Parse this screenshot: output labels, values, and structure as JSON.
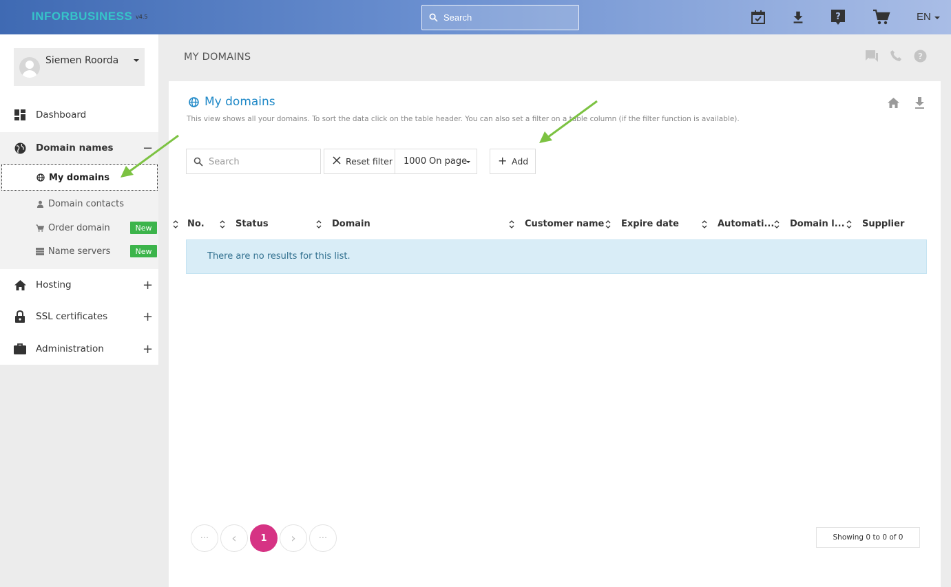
{
  "app": {
    "logo_text": "INFORBUSINESS",
    "version": "v4.5"
  },
  "header": {
    "search_placeholder": "Search",
    "icons": [
      "calendar-check-icon",
      "download-icon",
      "help-icon",
      "cart-icon"
    ],
    "language": "EN"
  },
  "user": {
    "name": "Siemen Roorda"
  },
  "sidebar": {
    "items": [
      {
        "label": "Dashboard",
        "icon": "dashboard-icon"
      },
      {
        "label": "Domain names",
        "icon": "globe-icon",
        "toggle": "−"
      },
      {
        "label": "Hosting",
        "icon": "home-icon",
        "toggle": "+"
      },
      {
        "label": "SSL certificates",
        "icon": "lock-icon",
        "toggle": "+"
      },
      {
        "label": "Administration",
        "icon": "briefcase-icon",
        "toggle": "+"
      }
    ],
    "sub_items": [
      {
        "label": "My domains",
        "icon": "globe-icon"
      },
      {
        "label": "Domain contacts",
        "icon": "person-icon"
      },
      {
        "label": "Order domain",
        "icon": "cart-icon",
        "badge": "New"
      },
      {
        "label": "Name servers",
        "icon": "server-icon",
        "badge": "New"
      }
    ]
  },
  "page": {
    "title": "MY DOMAINS",
    "top_icons": [
      "chat-icon",
      "phone-icon",
      "question-icon"
    ]
  },
  "card": {
    "title": "My domains",
    "description": "This view shows all your domains. To sort the data click on the table header. You can also set a filter on a table column (if the filter function is available).",
    "search_placeholder": "Search",
    "reset_label": "Reset filter",
    "per_page_value": "1000",
    "per_page_label": "On page",
    "add_label": "Add"
  },
  "table": {
    "columns": [
      "No.",
      "Status",
      "Domain",
      "Customer name",
      "Expire date",
      "Automati...",
      "Domain l...",
      "Supplier"
    ],
    "empty_message": "There are no results for this list."
  },
  "pagination": {
    "first": "···",
    "prev": "‹",
    "current": "1",
    "next": "›",
    "last": "···",
    "showing": "Showing 0 to 0 of 0"
  },
  "colors": {
    "accent": "#1e88c7",
    "badge_green": "#3cb44b",
    "page_active": "#d63384",
    "annotation_arrow": "#7cc242"
  }
}
